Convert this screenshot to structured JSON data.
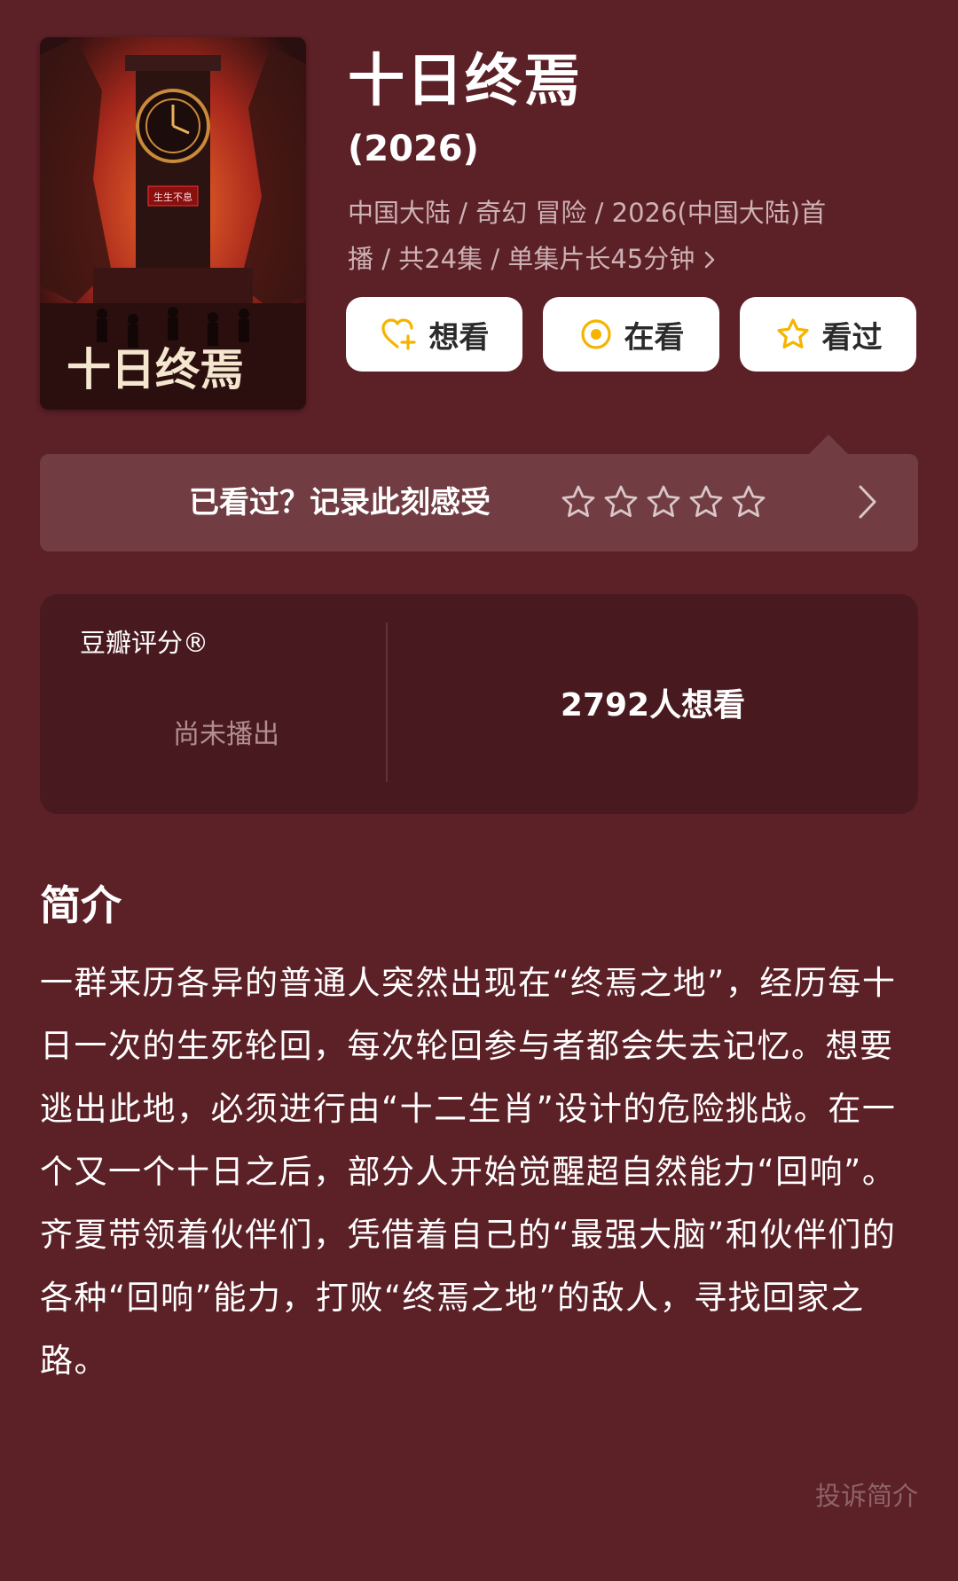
{
  "show": {
    "title": "十日终焉",
    "year": "(2026)",
    "meta_line1": "中国大陆 / 奇幻 冒险 / 2026(中国大陆)首",
    "meta_line2": "播 / 共24集 / 单集片长45分钟",
    "poster_text": "十日终焉",
    "poster_sign": "生生不息"
  },
  "actions": {
    "want": "想看",
    "watching": "在看",
    "watched": "看过"
  },
  "rating_bar": {
    "prompt": "已看过？记录此刻感受"
  },
  "score": {
    "label": "豆瓣评分®",
    "status": "尚未播出",
    "want_count": "2792人想看"
  },
  "intro": {
    "heading": "简介",
    "body": "一群来历各异的普通人突然出现在“终焉之地”，经历每十日一次的生死轮回，每次轮回参与者都会失去记忆。想要逃出此地，必须进行由“十二生肖”设计的危险挑战。在一个又一个十日之后，部分人开始觉醒超自然能力“回响”。齐夏带领着伙伴们，凭借着自己的“最强大脑”和伙伴们的各种“回响”能力，打败“终焉之地”的敌人，寻找回家之路。",
    "report": "投诉简介"
  },
  "colors": {
    "background": "#5c2027",
    "accent_yellow": "#f5b400"
  }
}
